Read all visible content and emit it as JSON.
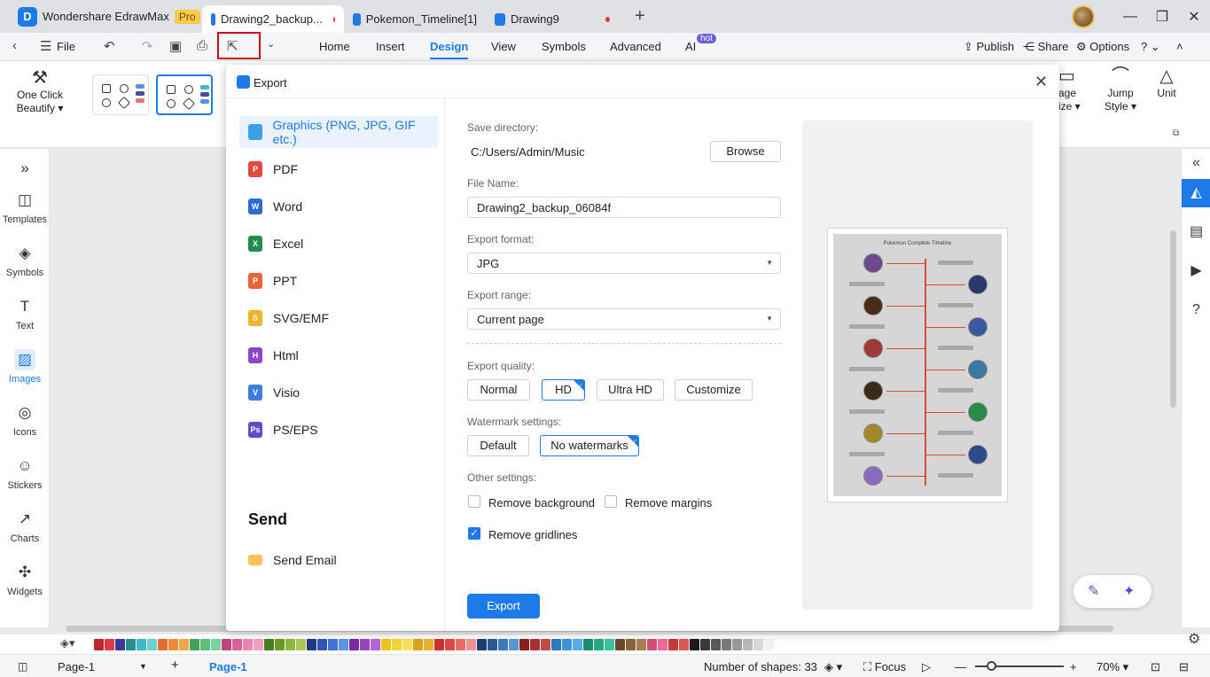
{
  "titlebar": {
    "app_name": "Wondershare EdrawMax",
    "pro_badge": "Pro",
    "tabs": [
      {
        "label": "Drawing2_backup...",
        "modified": true
      },
      {
        "label": "Pokemon_Timeline[1]",
        "modified": false
      },
      {
        "label": "Drawing9",
        "modified": true
      }
    ]
  },
  "menubar": {
    "file": "File",
    "tabs": [
      "Home",
      "Insert",
      "Design",
      "View",
      "Symbols",
      "Advanced",
      "AI"
    ],
    "active_tab": "Design",
    "ai_badge": "hot",
    "publish": "Publish",
    "share": "Share",
    "options": "Options"
  },
  "ribbon": {
    "one_click_beautify": "One Click",
    "one_click_beautify_2": "Beautify",
    "page_size_partial": "age",
    "page_size_partial_2": "ize",
    "jump_style": "Jump",
    "jump_style_2": "Style",
    "unit": "Unit"
  },
  "leftbar": {
    "items": [
      "Templates",
      "Symbols",
      "Text",
      "Images",
      "Icons",
      "Stickers",
      "Charts",
      "Widgets"
    ],
    "active": "Images"
  },
  "dialog": {
    "title": "Export",
    "formats": [
      {
        "label": "Graphics (PNG, JPG, GIF etc.)",
        "color": "#3aa0e8",
        "tag": ""
      },
      {
        "label": "PDF",
        "color": "#e5483b",
        "tag": "P"
      },
      {
        "label": "Word",
        "color": "#2b6bd8",
        "tag": "W"
      },
      {
        "label": "Excel",
        "color": "#1e8e4c",
        "tag": "X"
      },
      {
        "label": "PPT",
        "color": "#e5663b",
        "tag": "P"
      },
      {
        "label": "SVG/EMF",
        "color": "#f0b429",
        "tag": "S"
      },
      {
        "label": "Html",
        "color": "#8e44c9",
        "tag": "H"
      },
      {
        "label": "Visio",
        "color": "#3d7de0",
        "tag": "V"
      },
      {
        "label": "PS/EPS",
        "color": "#5b4fc9",
        "tag": "Ps"
      }
    ],
    "active_format": "Graphics (PNG, JPG, GIF etc.)",
    "send_title": "Send",
    "send_email": "Send Email",
    "save_directory_label": "Save directory:",
    "save_directory": "C:/Users/Admin/Music",
    "browse": "Browse",
    "file_name_label": "File Name:",
    "file_name": "Drawing2_backup_06084f",
    "export_format_label": "Export format:",
    "export_format": "JPG",
    "export_range_label": "Export range:",
    "export_range": "Current page",
    "export_quality_label": "Export quality:",
    "quality_options": [
      "Normal",
      "HD",
      "Ultra HD",
      "Customize"
    ],
    "quality_selected": "HD",
    "watermark_label": "Watermark settings:",
    "watermark_options": [
      "Default",
      "No watermarks"
    ],
    "watermark_selected": "No watermarks",
    "other_settings_label": "Other settings:",
    "remove_background": {
      "label": "Remove background",
      "checked": false
    },
    "remove_margins": {
      "label": "Remove margins",
      "checked": false
    },
    "remove_gridlines": {
      "label": "Remove gridlines",
      "checked": true
    },
    "export_button": "Export",
    "preview_title": "Pokemon Complete Timeline"
  },
  "statusbar": {
    "page_selector": "Page-1",
    "page_tab": "Page-1",
    "shapes": "Number of shapes: 33",
    "focus": "Focus",
    "zoom": "70%"
  },
  "palette_colors": [
    "#c0272d",
    "#e03b45",
    "#3a3a9e",
    "#2a8c8c",
    "#3fb8c6",
    "#66d1d8",
    "#e86d2d",
    "#f08a3a",
    "#f5a447",
    "#3fa35a",
    "#5cc07a",
    "#78d49a",
    "#c2437e",
    "#d9609a",
    "#ee86b3",
    "#f0a2c3",
    "#4a7d1f",
    "#6a9c2a",
    "#8bba3a",
    "#a9c95a",
    "#1f3a8a",
    "#2f56b8",
    "#3f74d6",
    "#5c92ea",
    "#7a2aa6",
    "#9a44c4",
    "#b663da",
    "#f0c419",
    "#f5d43a",
    "#f7e05a",
    "#e0a216",
    "#e6b430",
    "#d12f2f",
    "#e04848",
    "#ec6a6a",
    "#f39090",
    "#1d3f6e",
    "#2c5a94",
    "#3e78b8",
    "#5a96d2",
    "#8a1f1f",
    "#a83232",
    "#c44a4a",
    "#2a7abf",
    "#3d94d8",
    "#56acec",
    "#1a8f6e",
    "#28a884",
    "#3cc29c",
    "#6a4a2a",
    "#8a643c",
    "#a88052",
    "#d84a7a",
    "#ec6a94",
    "#c63a3a",
    "#e25454",
    "#1b1b1b",
    "#3a3a3a",
    "#5a5a5a",
    "#7a7a7a",
    "#9a9a9a",
    "#bababa",
    "#dadada",
    "#f2f2f2"
  ]
}
